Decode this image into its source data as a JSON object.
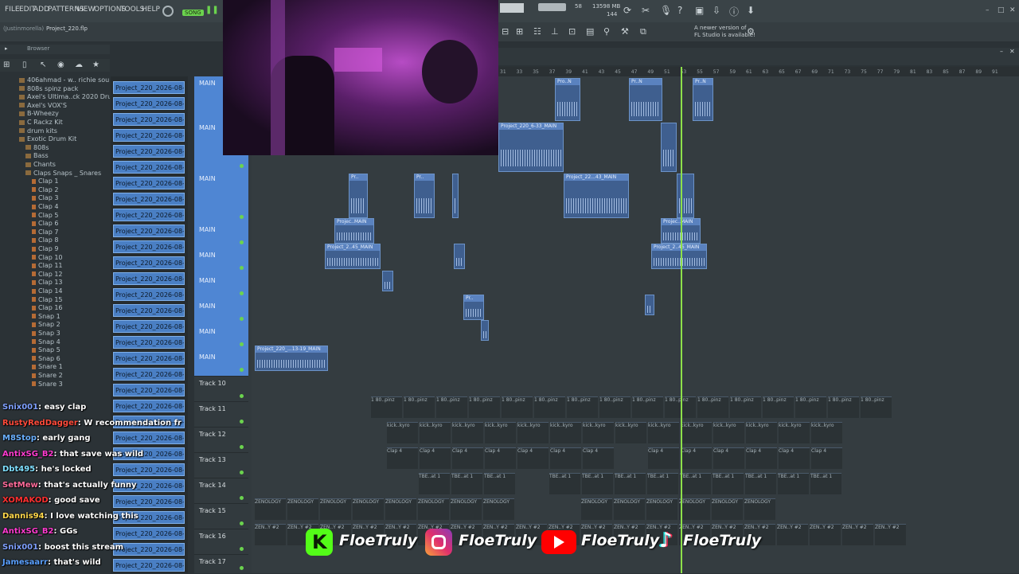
{
  "menu": [
    "FILE",
    "EDIT",
    "ADD",
    "PATTERNS",
    "VIEW",
    "OPTIONS",
    "TOOLS",
    "HELP"
  ],
  "song_badge": "SONG",
  "memory": {
    "mb": "13598 MB",
    "cpu": "144",
    "poly": "58"
  },
  "hint": {
    "line1": "A newer version of",
    "line2": "FL Studio is available!"
  },
  "project_file": "Project_220.flp",
  "project_user": "(Justinmorella)",
  "browser": {
    "title": "Browser",
    "items": [
      {
        "label": "406ahmad - w.. richie soul]",
        "indent": 2,
        "folder": true
      },
      {
        "label": "808s spinz pack",
        "indent": 2,
        "folder": true
      },
      {
        "label": "Axel's Ultima..ck 2020 Drums",
        "indent": 2,
        "folder": true
      },
      {
        "label": "Axel's VOX'S",
        "indent": 2,
        "folder": true
      },
      {
        "label": "B-Wheezy",
        "indent": 2,
        "folder": true
      },
      {
        "label": "C Rackz Kit",
        "indent": 2,
        "folder": true
      },
      {
        "label": "drum kits",
        "indent": 2,
        "folder": true
      },
      {
        "label": "Exotic Drum Kit",
        "indent": 2,
        "folder": true
      },
      {
        "label": "808s",
        "indent": 3,
        "folder": true
      },
      {
        "label": "Bass",
        "indent": 3,
        "folder": true
      },
      {
        "label": "Chants",
        "indent": 3,
        "folder": true
      },
      {
        "label": "Claps Snaps _ Snares",
        "indent": 3,
        "folder": true
      },
      {
        "label": "Clap 1",
        "indent": 4,
        "folder": false
      },
      {
        "label": "Clap 2",
        "indent": 4,
        "folder": false
      },
      {
        "label": "Clap 3",
        "indent": 4,
        "folder": false
      },
      {
        "label": "Clap 4",
        "indent": 4,
        "folder": false
      },
      {
        "label": "Clap 5",
        "indent": 4,
        "folder": false
      },
      {
        "label": "Clap 6",
        "indent": 4,
        "folder": false
      },
      {
        "label": "Clap 7",
        "indent": 4,
        "folder": false
      },
      {
        "label": "Clap 8",
        "indent": 4,
        "folder": false
      },
      {
        "label": "Clap 9",
        "indent": 4,
        "folder": false
      },
      {
        "label": "Clap 10",
        "indent": 4,
        "folder": false
      },
      {
        "label": "Clap 11",
        "indent": 4,
        "folder": false
      },
      {
        "label": "Clap 12",
        "indent": 4,
        "folder": false
      },
      {
        "label": "Clap 13",
        "indent": 4,
        "folder": false
      },
      {
        "label": "Clap 14",
        "indent": 4,
        "folder": false
      },
      {
        "label": "Clap 15",
        "indent": 4,
        "folder": false
      },
      {
        "label": "Clap 16",
        "indent": 4,
        "folder": false
      },
      {
        "label": "Snap 1",
        "indent": 4,
        "folder": false
      },
      {
        "label": "Snap 2",
        "indent": 4,
        "folder": false
      },
      {
        "label": "Snap 3",
        "indent": 4,
        "folder": false
      },
      {
        "label": "Snap 4",
        "indent": 4,
        "folder": false
      },
      {
        "label": "Snap 5",
        "indent": 4,
        "folder": false
      },
      {
        "label": "Snap 6",
        "indent": 4,
        "folder": false
      },
      {
        "label": "Snare 1",
        "indent": 4,
        "folder": false
      },
      {
        "label": "Snare 2",
        "indent": 4,
        "folder": false
      },
      {
        "label": "Snare 3",
        "indent": 4,
        "folder": false
      }
    ]
  },
  "channel_label": "Project_220_2026-08-13...",
  "channel_count": 31,
  "tracks": [
    {
      "name": "MAIN",
      "main": true
    },
    {
      "name": "MAIN",
      "main": true
    },
    {
      "name": "MAIN",
      "main": true
    },
    {
      "name": "MAIN",
      "main": true
    },
    {
      "name": "MAIN",
      "main": true
    },
    {
      "name": "MAIN",
      "main": true
    },
    {
      "name": "MAIN",
      "main": true
    },
    {
      "name": "MAIN",
      "main": true
    },
    {
      "name": "MAIN",
      "main": true
    },
    {
      "name": "Track 10",
      "main": false
    },
    {
      "name": "Track 11",
      "main": false
    },
    {
      "name": "Track 12",
      "main": false
    },
    {
      "name": "Track 13",
      "main": false
    },
    {
      "name": "Track 14",
      "main": false
    },
    {
      "name": "Track 15",
      "main": false
    },
    {
      "name": "Track 16",
      "main": false
    },
    {
      "name": "Track 17",
      "main": false
    }
  ],
  "ruler_ticks": [
    "31",
    "33",
    "35",
    "37",
    "39",
    "41",
    "43",
    "45",
    "47",
    "49",
    "51",
    "53",
    "55",
    "57",
    "59",
    "61",
    "63",
    "65",
    "67",
    "69",
    "71",
    "73",
    "75",
    "77",
    "79",
    "81",
    "83",
    "85",
    "87",
    "89",
    "91"
  ],
  "clips": [
    {
      "label": "Pro..N",
      "track": 0
    },
    {
      "label": "Pr..N",
      "track": 0
    },
    {
      "label": "Pr..N",
      "track": 0
    },
    {
      "label": "Project_220_6-33_MAIN",
      "track": 1
    },
    {
      "label": "Pr..",
      "track": 3
    },
    {
      "label": "Pr..",
      "track": 3
    },
    {
      "label": "Project_22...43_MAIN",
      "track": 3
    },
    {
      "label": "Projec..MAIN",
      "track": 4
    },
    {
      "label": "Projec..MAIN",
      "track": 4
    },
    {
      "label": "Project_2..45_MAIN",
      "track": 5
    },
    {
      "label": "Project_2..45_MAIN",
      "track": 5
    },
    {
      "label": "Pr..",
      "track": 7
    },
    {
      "label": "Project_220_...13-19_MAIN",
      "track": 8
    }
  ],
  "dark_rows": [
    {
      "track": 10,
      "label": "1 80..pinz"
    },
    {
      "track": 11,
      "label": "kick..kyro"
    },
    {
      "track": 12,
      "label": "Clap 4"
    },
    {
      "track": 13,
      "label": "TBE..at 1"
    },
    {
      "track": 14,
      "label": "ZENOLOGY"
    },
    {
      "track": 15,
      "label": "ZEN..Y #2"
    }
  ],
  "chat": [
    {
      "user": "Snix001",
      "msg": "easy clap",
      "color": "#7fa0ff"
    },
    {
      "user": "RustyRedDagger",
      "msg": "W recommendation fr",
      "color": "#ff4a3a"
    },
    {
      "user": "M8Stop",
      "msg": "early gang",
      "color": "#6ab0ff"
    },
    {
      "user": "AntixSG_B2",
      "msg": "that save was wild",
      "color": "#ff3bd0"
    },
    {
      "user": "Dbt495",
      "msg": "he's locked",
      "color": "#7fe0ff"
    },
    {
      "user": "SetMew",
      "msg": "that's actually funny",
      "color": "#ff6b9a"
    },
    {
      "user": "XOMAKOD",
      "msg": "good save",
      "color": "#ff3030"
    },
    {
      "user": "Dannis94",
      "msg": "I love watching this",
      "color": "#ffd84a"
    },
    {
      "user": "AntixSG_B2",
      "msg": "GGs",
      "color": "#ff3bd0"
    },
    {
      "user": "Snix001",
      "msg": "boost this stream",
      "color": "#7fa0ff"
    },
    {
      "user": "Jamesaarr",
      "msg": "that's wild",
      "color": "#5aa0ff"
    }
  ],
  "socials": {
    "kick": "FloeTruly",
    "instagram": "FloeTruly",
    "youtube": "FloeTruly",
    "tiktok": "FloeTruly"
  },
  "colors": {
    "accent": "#4f86d3",
    "playhead": "#8de04a",
    "kick": "#53fc18",
    "youtube": "#ff0000"
  }
}
